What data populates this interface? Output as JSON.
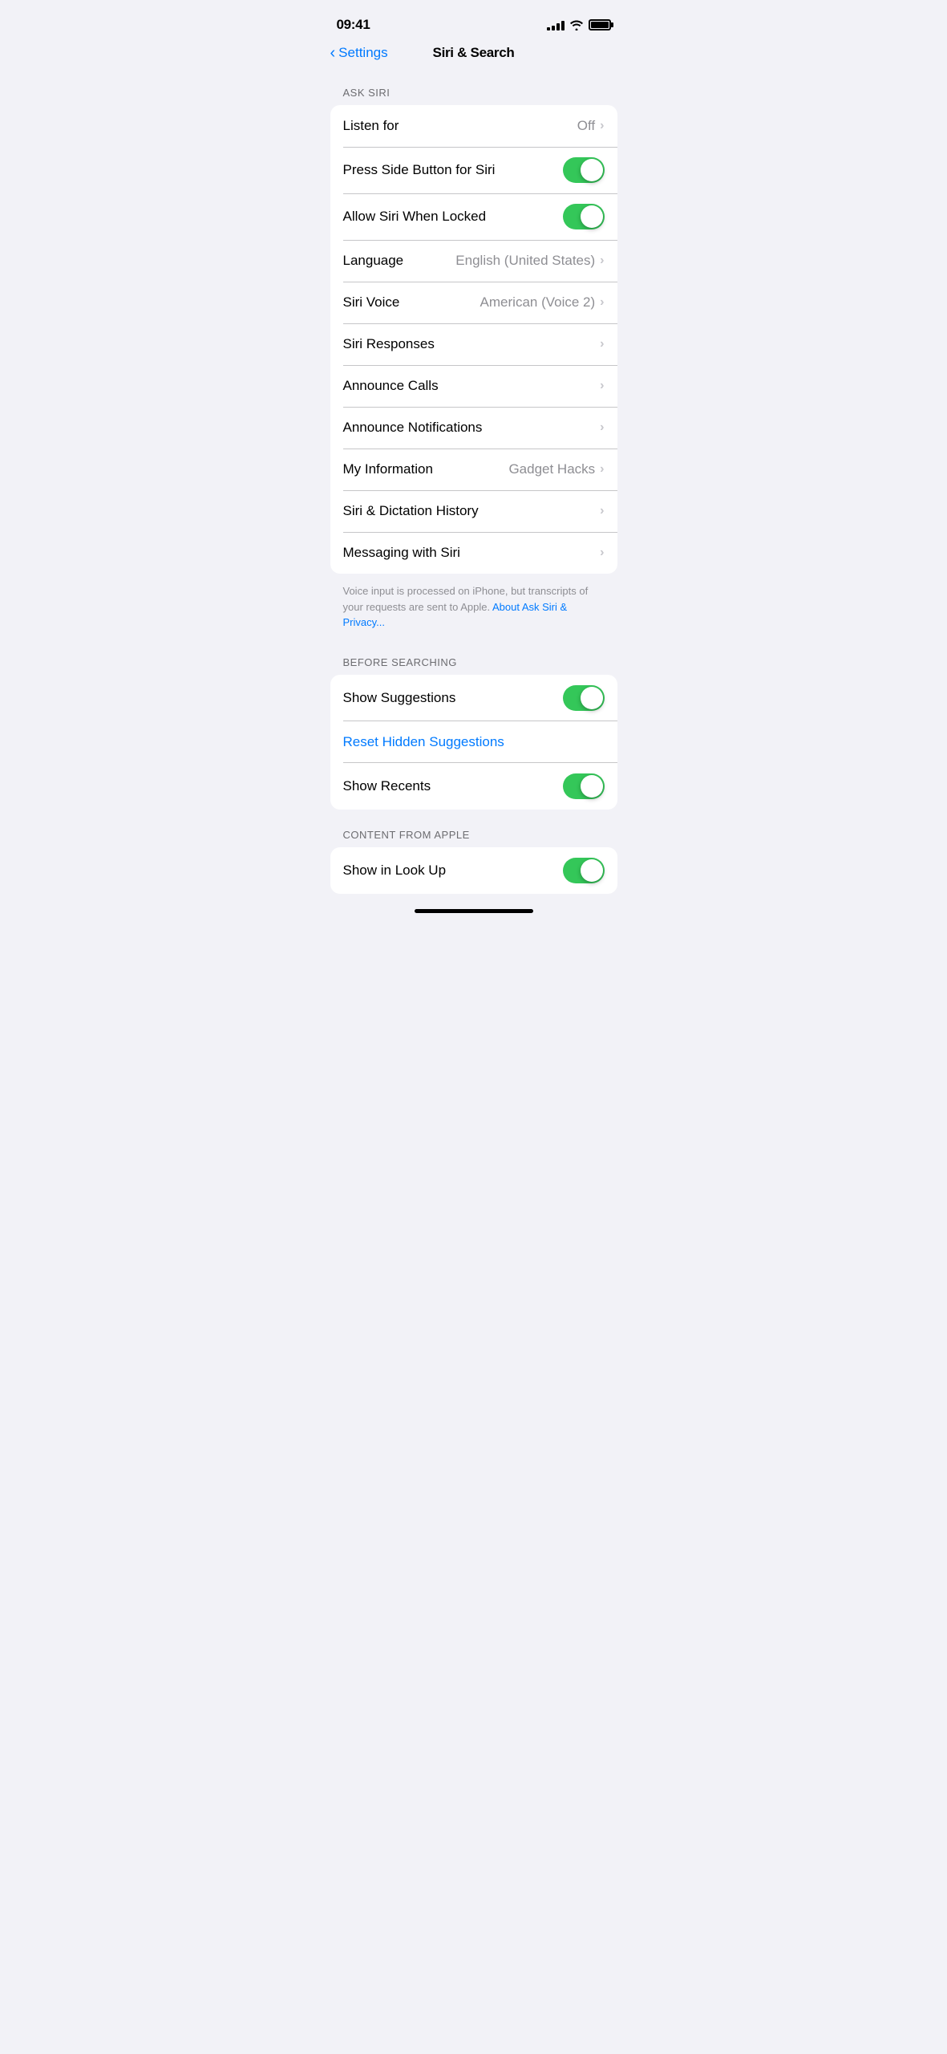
{
  "statusBar": {
    "time": "09:41",
    "signalBars": [
      4,
      6,
      9,
      11,
      13
    ],
    "battery": 100
  },
  "header": {
    "backLabel": "Settings",
    "title": "Siri & Search"
  },
  "sections": {
    "askSiri": {
      "label": "ASK SIRI",
      "rows": [
        {
          "id": "listen-for",
          "label": "Listen for",
          "rightText": "Off",
          "hasChevron": true,
          "hasToggle": false
        },
        {
          "id": "press-side-button",
          "label": "Press Side Button for Siri",
          "rightText": "",
          "hasChevron": false,
          "hasToggle": true,
          "toggleOn": true
        },
        {
          "id": "allow-siri-locked",
          "label": "Allow Siri When Locked",
          "rightText": "",
          "hasChevron": false,
          "hasToggle": true,
          "toggleOn": true
        },
        {
          "id": "language",
          "label": "Language",
          "rightText": "English (United States)",
          "hasChevron": true,
          "hasToggle": false
        },
        {
          "id": "siri-voice",
          "label": "Siri Voice",
          "rightText": "American (Voice 2)",
          "hasChevron": true,
          "hasToggle": false
        },
        {
          "id": "siri-responses",
          "label": "Siri Responses",
          "rightText": "",
          "hasChevron": true,
          "hasToggle": false
        },
        {
          "id": "announce-calls",
          "label": "Announce Calls",
          "rightText": "",
          "hasChevron": true,
          "hasToggle": false
        },
        {
          "id": "announce-notifications",
          "label": "Announce Notifications",
          "rightText": "",
          "hasChevron": true,
          "hasToggle": false
        },
        {
          "id": "my-information",
          "label": "My Information",
          "rightText": "Gadget Hacks",
          "hasChevron": true,
          "hasToggle": false
        },
        {
          "id": "siri-dictation-history",
          "label": "Siri & Dictation History",
          "rightText": "",
          "hasChevron": true,
          "hasToggle": false
        },
        {
          "id": "messaging-with-siri",
          "label": "Messaging with Siri",
          "rightText": "",
          "hasChevron": true,
          "hasToggle": false
        }
      ],
      "footerText": "Voice input is processed on iPhone, but transcripts of your requests are sent to Apple.",
      "footerLinkText": "About Ask Siri & Privacy...",
      "footerLinkHref": "#"
    },
    "beforeSearching": {
      "label": "BEFORE SEARCHING",
      "rows": [
        {
          "id": "show-suggestions",
          "label": "Show Suggestions",
          "rightText": "",
          "hasChevron": false,
          "hasToggle": true,
          "toggleOn": true
        },
        {
          "id": "reset-hidden-suggestions",
          "label": "Reset Hidden Suggestions",
          "isLink": true,
          "hasToggle": false,
          "hasChevron": false
        },
        {
          "id": "show-recents",
          "label": "Show Recents",
          "rightText": "",
          "hasChevron": false,
          "hasToggle": true,
          "toggleOn": true
        }
      ]
    },
    "contentFromApple": {
      "label": "CONTENT FROM APPLE",
      "rows": [
        {
          "id": "show-in-look-up",
          "label": "Show in Look Up",
          "rightText": "",
          "hasChevron": false,
          "hasToggle": true,
          "toggleOn": true
        }
      ]
    }
  }
}
